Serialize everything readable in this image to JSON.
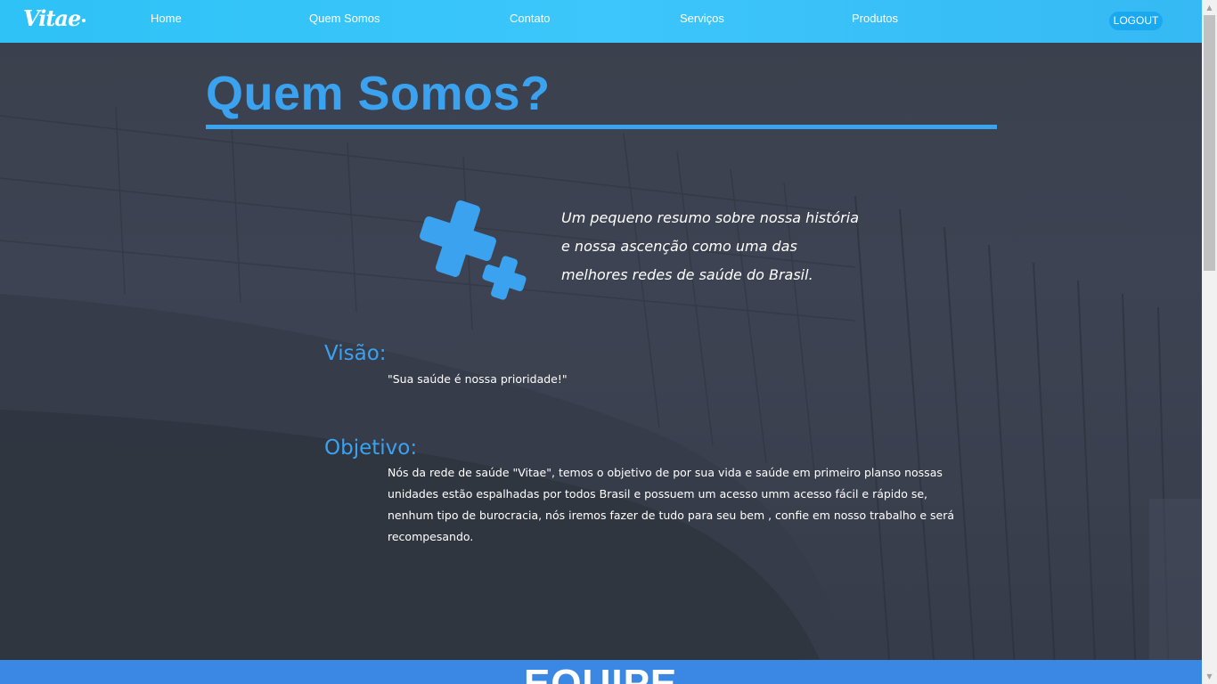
{
  "header": {
    "logo_text": "Vitae",
    "nav": {
      "home": "Home",
      "quem_somos": "Quem Somos",
      "contato": "Contato",
      "servicos": "Serviços",
      "produtos": "Produtos"
    },
    "logout_label": "LOGOUT"
  },
  "main": {
    "title": "Quem Somos?",
    "summary": "Um pequeno resumo sobre nossa história e nossa ascenção como uma das melhores redes de saúde do Brasil.",
    "visao": {
      "heading": "Visão:",
      "text": "\"Sua saúde é nossa prioridade!\""
    },
    "objetivo": {
      "heading": "Objetivo:",
      "text": "Nós da rede de saúde \"Vitae\", temos o objetivo de por sua vida e saúde em primeiro planso nossas unidades estão espalhadas por todos Brasil e possuem um acesso umm acesso fácil e rápido se, nenhum tipo de burocracia, nós iremos fazer de tudo para seu bem , confie em nosso trabalho e será recompesando."
    }
  },
  "equipe": {
    "title": "EQUIPE"
  },
  "icons": {
    "logo": "vitae-logo-icon",
    "cross": "medical-cross-icon"
  },
  "colors": {
    "header": "#36c2f8",
    "accent": "#3ba2f0",
    "logout_bg": "#1aa9ef",
    "equipe_band": "#3a88e3"
  }
}
